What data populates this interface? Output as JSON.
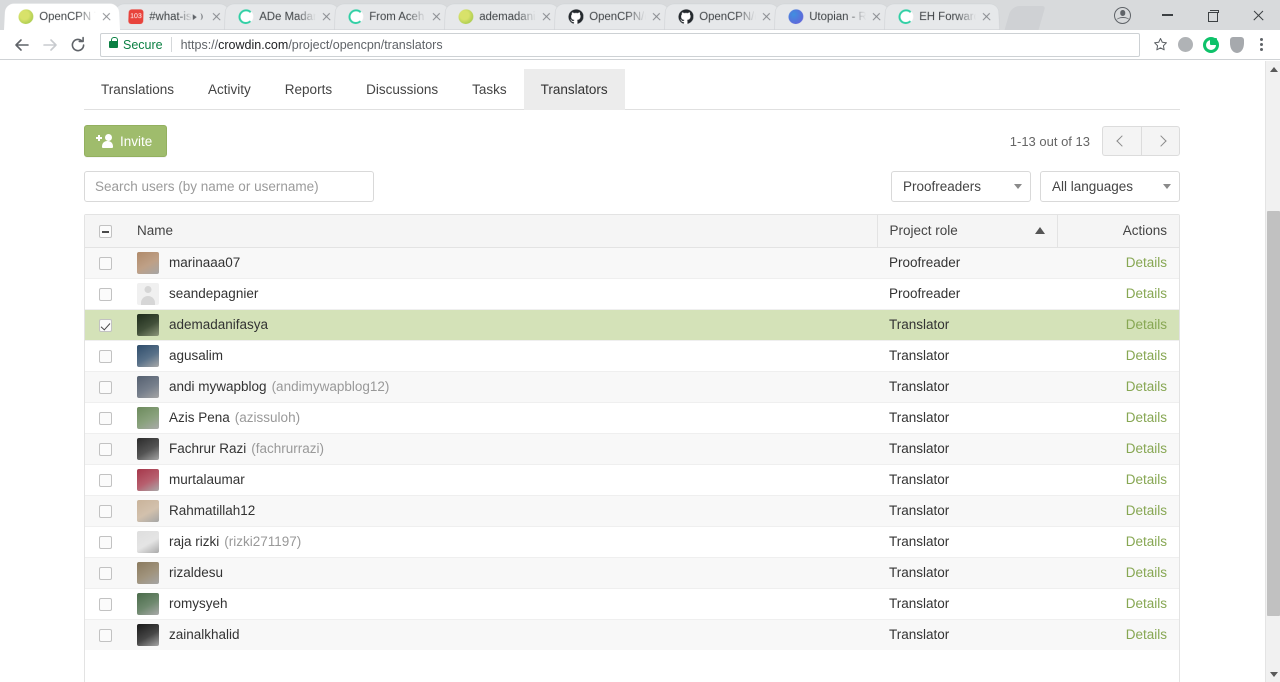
{
  "browser": {
    "tabs": [
      {
        "title": "OpenCPN T",
        "favicon": "opencpn-icon",
        "active": true,
        "muted": false
      },
      {
        "title": "#what-is",
        "favicon": "messenger-icon",
        "active": false,
        "muted": true,
        "badge": "103"
      },
      {
        "title": "ADe Madan",
        "favicon": "crowdin-icon",
        "active": false,
        "muted": false
      },
      {
        "title": "From Aceh",
        "favicon": "crowdin-icon",
        "active": false,
        "muted": false
      },
      {
        "title": "ademadani",
        "favicon": "opencpn-icon",
        "active": false,
        "muted": false
      },
      {
        "title": "OpenCPN/(",
        "favicon": "github-icon",
        "active": false,
        "muted": false
      },
      {
        "title": "OpenCPN/(",
        "favicon": "github-icon",
        "active": false,
        "muted": false
      },
      {
        "title": "Utopian - R",
        "favicon": "utopian-icon",
        "active": false,
        "muted": false
      },
      {
        "title": "EH Forward",
        "favicon": "crowdin-icon",
        "active": false,
        "muted": false
      }
    ],
    "new_tab_label": "new-tab",
    "window_controls": {
      "minimize": "minimize",
      "maximize": "maximize",
      "close": "close",
      "profile": "profile"
    },
    "nav": {
      "back": "back",
      "forward": "forward",
      "reload": "reload"
    },
    "address": {
      "security_label": "Secure",
      "scheme": "https://",
      "host": "crowdin.com",
      "path": "/project/opencpn/translators"
    },
    "toolbar_icons": [
      "bookmark-star-icon",
      "grape-extension-icon",
      "grammarly-extension-icon",
      "shield-extension-icon",
      "chrome-menu-icon"
    ]
  },
  "page": {
    "nav_tabs": [
      {
        "label": "Translations",
        "active": false
      },
      {
        "label": "Activity",
        "active": false
      },
      {
        "label": "Reports",
        "active": false
      },
      {
        "label": "Discussions",
        "active": false
      },
      {
        "label": "Tasks",
        "active": false
      },
      {
        "label": "Translators",
        "active": true
      }
    ],
    "invite_button": "Invite",
    "pagination": {
      "count_text": "1-13 out of 13",
      "prev_label": "previous-page",
      "next_label": "next-page"
    },
    "search": {
      "placeholder": "Search users (by name or username)",
      "value": ""
    },
    "filters": {
      "role": {
        "selected": "Proofreaders"
      },
      "language": {
        "selected": "All languages"
      }
    },
    "table": {
      "headers": {
        "select_all": "select-all",
        "name": "Name",
        "role": "Project role",
        "actions": "Actions",
        "sort_direction": "asc"
      },
      "rows": [
        {
          "name": "marinaaa07",
          "username": "",
          "role": "Proofreader",
          "action": "Details",
          "checked": false,
          "avatar": "photo",
          "avatar_color": "#b08a6a"
        },
        {
          "name": "seandepagnier",
          "username": "",
          "role": "Proofreader",
          "action": "Details",
          "checked": false,
          "avatar": "placeholder",
          "avatar_color": "#f0f0f0"
        },
        {
          "name": "ademadanifasya",
          "username": "",
          "role": "Translator",
          "action": "Details",
          "checked": true,
          "avatar": "photo",
          "avatar_color": "#1d2b1a"
        },
        {
          "name": "agusalim",
          "username": "",
          "role": "Translator",
          "action": "Details",
          "checked": false,
          "avatar": "photo",
          "avatar_color": "#2f4d6b"
        },
        {
          "name": "andi mywapblog",
          "username": "(andimywapblog12)",
          "role": "Translator",
          "action": "Details",
          "checked": false,
          "avatar": "photo",
          "avatar_color": "#556070"
        },
        {
          "name": "Azis Pena",
          "username": "(azissuloh)",
          "role": "Translator",
          "action": "Details",
          "checked": false,
          "avatar": "photo",
          "avatar_color": "#6c8a5c"
        },
        {
          "name": "Fachrur Razi",
          "username": "(fachrurrazi)",
          "role": "Translator",
          "action": "Details",
          "checked": false,
          "avatar": "photo",
          "avatar_color": "#2b2b2b"
        },
        {
          "name": "murtalaumar",
          "username": "",
          "role": "Translator",
          "action": "Details",
          "checked": false,
          "avatar": "photo",
          "avatar_color": "#a5374a"
        },
        {
          "name": "Rahmatillah12",
          "username": "",
          "role": "Translator",
          "action": "Details",
          "checked": false,
          "avatar": "photo",
          "avatar_color": "#c9b39a"
        },
        {
          "name": "raja rizki",
          "username": "(rizki271197)",
          "role": "Translator",
          "action": "Details",
          "checked": false,
          "avatar": "photo",
          "avatar_color": "#dedede"
        },
        {
          "name": "rizaldesu",
          "username": "",
          "role": "Translator",
          "action": "Details",
          "checked": false,
          "avatar": "photo",
          "avatar_color": "#8a7a5e"
        },
        {
          "name": "romysyeh",
          "username": "",
          "role": "Translator",
          "action": "Details",
          "checked": false,
          "avatar": "photo",
          "avatar_color": "#4a6b4a"
        },
        {
          "name": "zainalkhalid",
          "username": "",
          "role": "Translator",
          "action": "Details",
          "checked": false,
          "avatar": "photo",
          "avatar_color": "#1a1a1a"
        }
      ]
    }
  },
  "colors": {
    "accent_green": "#9fbc6c",
    "link_green": "#87a753",
    "selected_row": "#d4e2b8",
    "secure_green": "#0b8043"
  }
}
